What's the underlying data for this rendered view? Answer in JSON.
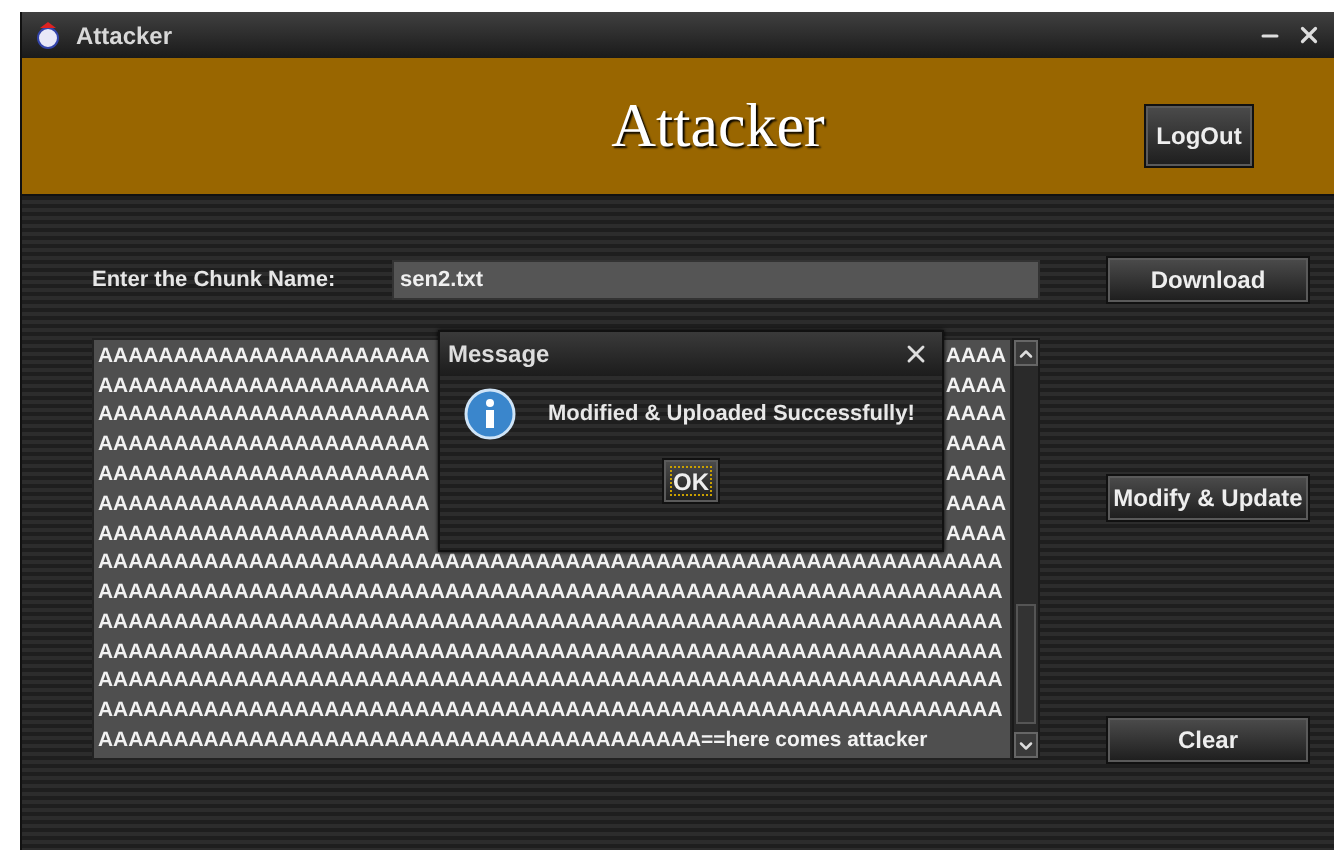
{
  "window": {
    "title": "Attacker"
  },
  "banner": {
    "title": "Attacker",
    "logout_button": "LogOut"
  },
  "form": {
    "label": "Enter the Chunk Name:",
    "value": "sen2.txt",
    "button": "Download"
  },
  "text_area": {
    "lines": [
      {
        "segments": [
          "AAAAAAAAAAAAAAAAAAAAAA",
          "AAAA"
        ]
      },
      {
        "segments": [
          "AAAAAAAAAAAAAAAAAAAAAA",
          "AAAA"
        ]
      },
      {
        "segments": [
          "AAAAAAAAAAAAAAAAAAAAAA",
          "AAAA"
        ]
      },
      {
        "segments": [
          "AAAAAAAAAAAAAAAAAAAAAA",
          "AAAA"
        ]
      },
      {
        "segments": [
          "AAAAAAAAAAAAAAAAAAAAAA",
          "AAAA"
        ]
      },
      {
        "segments": [
          "AAAAAAAAAAAAAAAAAAAAAA",
          "AAAA"
        ]
      },
      {
        "segments": [
          "AAAAAAAAAAAAAAAAAAAAAA",
          "AAAA"
        ]
      },
      {
        "segments": [
          "AAAAAAAAAAAAAAAAAAAAAAAAAAAAAAAAAAAAAAAAAAAAAAAAAAAAAAAAAAAA"
        ]
      },
      {
        "segments": [
          "AAAAAAAAAAAAAAAAAAAAAAAAAAAAAAAAAAAAAAAAAAAAAAAAAAAAAAAAAAAA"
        ]
      },
      {
        "segments": [
          "AAAAAAAAAAAAAAAAAAAAAAAAAAAAAAAAAAAAAAAAAAAAAAAAAAAAAAAAAAAA"
        ]
      },
      {
        "segments": [
          "AAAAAAAAAAAAAAAAAAAAAAAAAAAAAAAAAAAAAAAAAAAAAAAAAAAAAAAAAAAA"
        ]
      },
      {
        "segments": [
          "AAAAAAAAAAAAAAAAAAAAAAAAAAAAAAAAAAAAAAAAAAAAAAAAAAAAAAAAAAAA"
        ]
      },
      {
        "segments": [
          "AAAAAAAAAAAAAAAAAAAAAAAAAAAAAAAAAAAAAAAAAAAAAAAAAAAAAAAAAAAA"
        ]
      },
      {
        "segments": [
          "AAAAAAAAAAAAAAAAAAAAAAAAAAAAAAAAAAAAAAAA==here comes attacker"
        ]
      }
    ]
  },
  "side_buttons": [
    "Modify & Update",
    "Clear"
  ],
  "dialog": {
    "title": "Message",
    "message": "Modified & Uploaded Successfully!",
    "button": "OK"
  }
}
